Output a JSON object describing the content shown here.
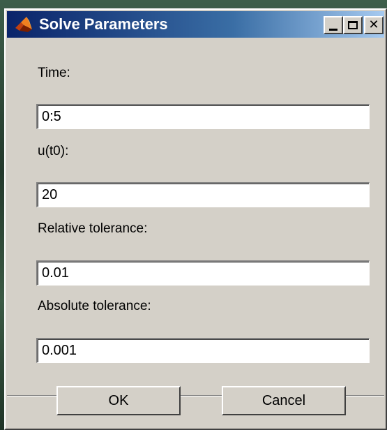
{
  "window": {
    "title": "Solve Parameters",
    "icon": "matlab-icon",
    "controls": {
      "minimize_icon": "minimize-icon",
      "maximize_icon": "maximize-icon",
      "close_glyph": "✕"
    }
  },
  "fields": [
    {
      "label": "Time:",
      "value": "0:5"
    },
    {
      "label": "u(t0):",
      "value": "20"
    },
    {
      "label": "Relative tolerance:",
      "value": "0.01"
    },
    {
      "label": "Absolute tolerance:",
      "value": "0.001"
    }
  ],
  "buttons": {
    "ok_label": "OK",
    "cancel_label": "Cancel"
  },
  "colors": {
    "titlebar_start": "#0a246a",
    "titlebar_end": "#a6caf0",
    "dialog_face": "#d4d0c8"
  }
}
